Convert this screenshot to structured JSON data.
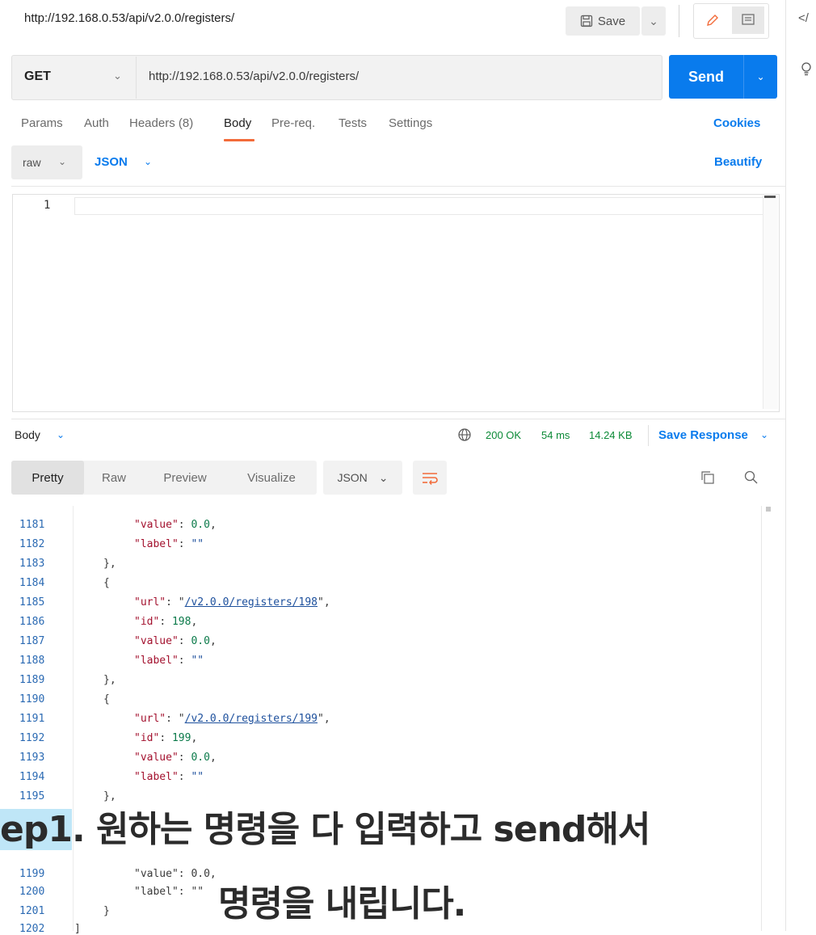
{
  "tab": {
    "title_url": "http://192.168.0.53/api/v2.0.0/registers/",
    "save_label": "Save"
  },
  "right_rail": {
    "code_icon": "</"
  },
  "request": {
    "method": "GET",
    "url": "http://192.168.0.53/api/v2.0.0/registers/",
    "send_label": "Send"
  },
  "request_tabs": {
    "params": "Params",
    "auth": "Auth",
    "headers": "Headers (8)",
    "body": "Body",
    "prereq": "Pre-req.",
    "tests": "Tests",
    "settings": "Settings",
    "cookies": "Cookies"
  },
  "body_mode": {
    "mode": "raw",
    "language": "JSON",
    "beautify": "Beautify"
  },
  "editor": {
    "line_number": "1"
  },
  "response": {
    "body_label": "Body",
    "status": "200 OK",
    "time": "54 ms",
    "size": "14.24 KB",
    "save_response": "Save Response",
    "view_tabs": {
      "pretty": "Pretty",
      "raw": "Raw",
      "preview": "Preview",
      "visualize": "Visualize"
    },
    "format": "JSON"
  },
  "code_lines": [
    {
      "n": "1181",
      "k": "value",
      "v": "0.0",
      "vt": "num",
      "comma": ","
    },
    {
      "n": "1182",
      "k": "label",
      "v": "\"\"",
      "vt": "str",
      "comma": ""
    },
    {
      "n": "1183",
      "t": "},",
      "indent": 1
    },
    {
      "n": "1184",
      "t": "{",
      "indent": 1
    },
    {
      "n": "1185",
      "k": "url",
      "v": "/v2.0.0/registers/198",
      "vt": "link",
      "comma": ","
    },
    {
      "n": "1186",
      "k": "id",
      "v": "198",
      "vt": "num",
      "comma": ","
    },
    {
      "n": "1187",
      "k": "value",
      "v": "0.0",
      "vt": "num",
      "comma": ","
    },
    {
      "n": "1188",
      "k": "label",
      "v": "\"\"",
      "vt": "str",
      "comma": ""
    },
    {
      "n": "1189",
      "t": "},",
      "indent": 1
    },
    {
      "n": "1190",
      "t": "{",
      "indent": 1
    },
    {
      "n": "1191",
      "k": "url",
      "v": "/v2.0.0/registers/199",
      "vt": "link",
      "comma": ","
    },
    {
      "n": "1192",
      "k": "id",
      "v": "199",
      "vt": "num",
      "comma": ","
    },
    {
      "n": "1193",
      "k": "value",
      "v": "0.0",
      "vt": "num",
      "comma": ","
    },
    {
      "n": "1194",
      "k": "label",
      "v": "\"\"",
      "vt": "str",
      "comma": ""
    },
    {
      "n": "1195",
      "t": "},",
      "indent": 1
    },
    {
      "n": "1199",
      "t": "\"value\": 0.0,",
      "indent": 2
    },
    {
      "n": "1200",
      "t": "\"label\": \"\"",
      "indent": 2
    },
    {
      "n": "1201",
      "t": "}",
      "indent": 1
    },
    {
      "n": "1202",
      "t": "]",
      "indent": 0
    }
  ],
  "caption": {
    "highlight": "ep1",
    "line1_rest": ". 원하는 명령을 다 입력하고 send해서",
    "line2": "명령을 내립니다."
  }
}
